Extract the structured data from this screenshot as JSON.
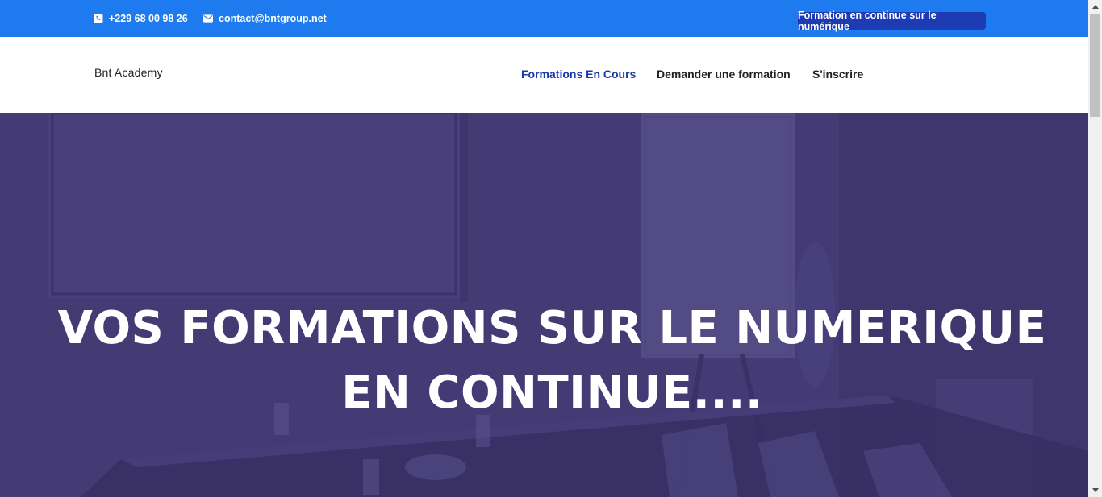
{
  "topbar": {
    "phone": "+229 68 00 98 26",
    "email": "contact@bntgroup.net",
    "badge": "Formation en continue sur le numérique",
    "phone_icon": "phone-icon",
    "email_icon": "envelope-icon",
    "background_color": "#1e7bef",
    "badge_color": "#1d3bb3"
  },
  "navbar": {
    "brand": "Bnt Academy",
    "items": [
      {
        "label": "Formations En Cours",
        "active": true
      },
      {
        "label": "Demander une formation",
        "active": false
      },
      {
        "label": "S'inscrire",
        "active": false
      }
    ],
    "active_color": "#1a3aa8"
  },
  "hero": {
    "title_line1": "VOS FORMATIONS SUR LE NUMERIQUE",
    "title_line2": "EN CONTINUE....",
    "overlay_color": "#433c70"
  },
  "scrollbar": {
    "up_icon": "chevron-up-icon",
    "down_icon": "chevron-down-icon"
  }
}
